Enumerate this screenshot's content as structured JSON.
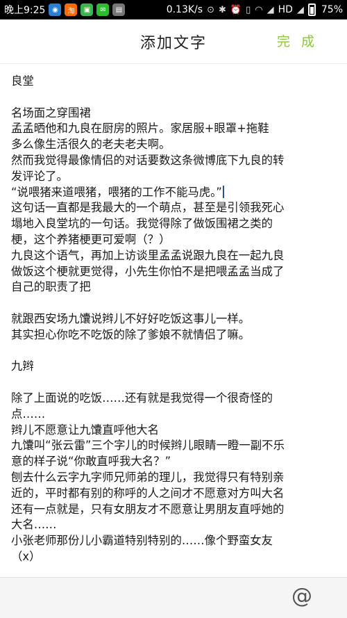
{
  "status_bar": {
    "time": "晚上9:25",
    "network_speed": "0.13K/s",
    "network_type": "HD",
    "battery": "75%"
  },
  "header": {
    "title": "添加文字",
    "done_label": "完 成"
  },
  "editor": {
    "lines": [
      "良堂",
      "",
      "名场面之穿围裙",
      "孟孟晒他和九良在厨房的照片。家居服+眼罩+拖鞋",
      "多么像生活很久的老夫老夫啊。",
      "然而我觉得最像情侣的对话要数这条微博底下九良的转",
      "发评论了。",
      "“说喂猪来道喂猪，喂猪的工作不能马虎。”",
      "这句话一直都是我最大的一个萌点，甚至是引领我死心",
      "塌地入良堂坑的一句话。我觉得除了做饭围裙之类的",
      "梗，这个养猪梗更可爱啊（？）",
      "九良这个语气，再加上访谈里孟孟说跟九良在一起九良",
      "做饭这个梗就更觉得，小先生你怕不是把喂孟孟当成了",
      "自己的职责了把",
      "",
      "就跟西安场九馕说辫儿不好好吃饭这事儿一样。",
      "其实担心你吃不吃饭的除了爹娘不就情侣了嘛。",
      "",
      "九辫",
      "",
      "除了上面说的吃饭……还有就是我觉得一个很奇怪的",
      "点……",
      "辫儿不愿意让九馕直呼他大名",
      "九馕叫“张云雷”三个字儿的时候辫儿眼睛一瞪一副不乐",
      "意的样子说“你敢直呼我大名？”",
      "刨去什么云字九字师兄师弟的理儿，我觉得只有特别亲",
      "近的，平时都有别的称呼的人之间才不愿意对方叫大名",
      "还有一点就是，只有女朋友才不愿意让男朋友直呼她的",
      "大名……",
      "小张老师那份儿小霸道特别特别的……像个野蛮女友",
      "（x）"
    ]
  },
  "bottom_bar": {
    "mention_symbol": "@"
  }
}
